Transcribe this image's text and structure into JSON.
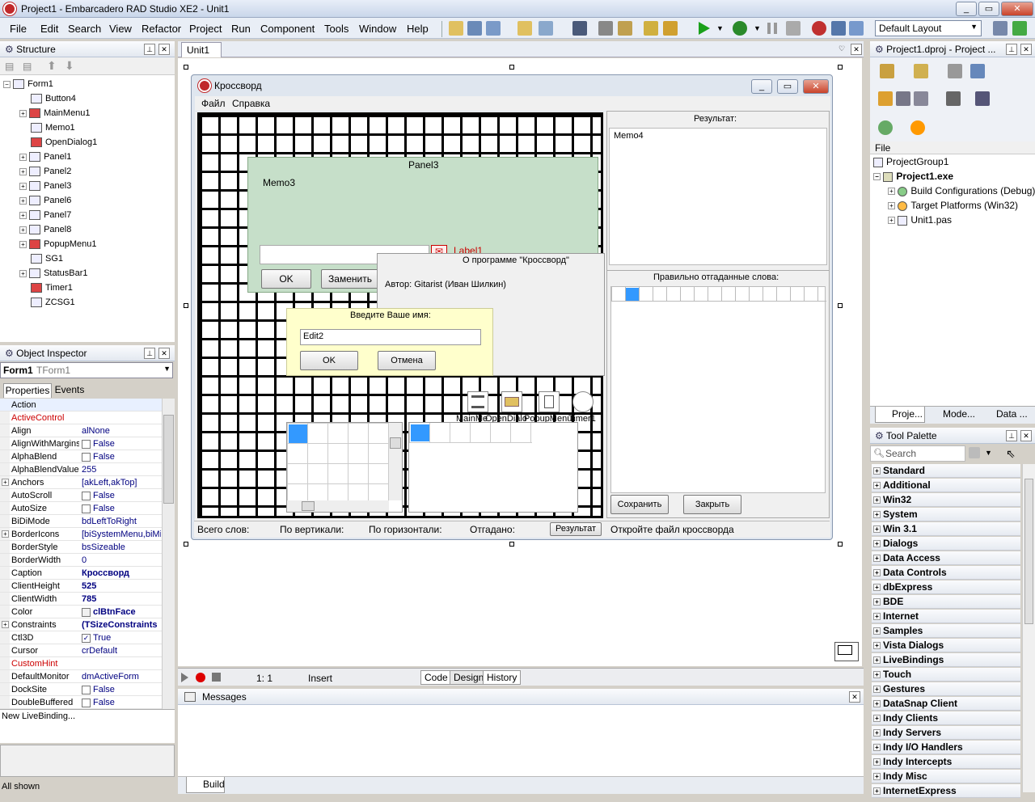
{
  "window": {
    "title": "Project1 - Embarcadero RAD Studio XE2 - Unit1"
  },
  "menu": [
    "File",
    "Edit",
    "Search",
    "View",
    "Refactor",
    "Project",
    "Run",
    "Component",
    "Tools",
    "Window",
    "Help"
  ],
  "layout_combo": "Default Layout",
  "structure": {
    "title": "Structure",
    "items": [
      "Form1",
      "Button4",
      "MainMenu1",
      "Memo1",
      "OpenDialog1",
      "Panel1",
      "Panel2",
      "Panel3",
      "Panel6",
      "Panel7",
      "Panel8",
      "PopupMenu1",
      "SG1",
      "StatusBar1",
      "Timer1",
      "ZCSG1"
    ]
  },
  "inspector": {
    "title": "Object Inspector",
    "selected": "Form1",
    "selected_type": "TForm1",
    "tabs": [
      "Properties",
      "Events"
    ],
    "props": [
      {
        "n": "Action",
        "v": ""
      },
      {
        "n": "ActiveControl",
        "v": ""
      },
      {
        "n": "Align",
        "v": "alNone"
      },
      {
        "n": "AlignWithMargins",
        "v": "False"
      },
      {
        "n": "AlphaBlend",
        "v": "False"
      },
      {
        "n": "AlphaBlendValue",
        "v": "255"
      },
      {
        "n": "Anchors",
        "v": "[akLeft,akTop]"
      },
      {
        "n": "AutoScroll",
        "v": "False"
      },
      {
        "n": "AutoSize",
        "v": "False"
      },
      {
        "n": "BiDiMode",
        "v": "bdLeftToRight"
      },
      {
        "n": "BorderIcons",
        "v": "[biSystemMenu,biMin"
      },
      {
        "n": "BorderStyle",
        "v": "bsSizeable"
      },
      {
        "n": "BorderWidth",
        "v": "0"
      },
      {
        "n": "Caption",
        "v": "Кроссворд"
      },
      {
        "n": "ClientHeight",
        "v": "525"
      },
      {
        "n": "ClientWidth",
        "v": "785"
      },
      {
        "n": "Color",
        "v": "clBtnFace"
      },
      {
        "n": "Constraints",
        "v": "(TSizeConstraints"
      },
      {
        "n": "Ctl3D",
        "v": "True"
      },
      {
        "n": "Cursor",
        "v": "crDefault"
      },
      {
        "n": "CustomHint",
        "v": ""
      },
      {
        "n": "DefaultMonitor",
        "v": "dmActiveForm"
      },
      {
        "n": "DockSite",
        "v": "False"
      },
      {
        "n": "DoubleBuffered",
        "v": "False"
      }
    ],
    "livebinding": "New LiveBinding...",
    "status": "All shown"
  },
  "editor": {
    "tab": "Unit1",
    "position": "1:  1",
    "mode": "Insert",
    "bottom_tabs": [
      "Code",
      "Design",
      "History"
    ]
  },
  "form": {
    "title": "Кроссворд",
    "menu": [
      "Файл",
      "Справка"
    ],
    "panel3_caption": "Panel3",
    "memo3": "Memo3",
    "label1": "Label1",
    "ok": "OK",
    "replace": "Заменить",
    "about_title": "О программе \"Кроссворд\"",
    "about_author": "Автор: Gitarist (Иван Шилкин)",
    "name_prompt": "Введите Ваше имя:",
    "edit2": "Edit2",
    "ok2": "OK",
    "cancel": "Отмена",
    "result_label": "Результат:",
    "memo4": "Memo4",
    "correct_words": "Правильно отгаданные слова:",
    "save": "Сохранить",
    "close": "Закрыть",
    "components": [
      "MainMe",
      "OpenDialo",
      "PopupMenu",
      "Timer1"
    ],
    "status": [
      "Всего слов:",
      "По вертикали:",
      "По горизонтали:",
      "Отгадано:",
      "Результат",
      "Откройте файл кроссворда"
    ]
  },
  "messages": {
    "title": "Messages",
    "tab": "Build"
  },
  "project": {
    "title": "Project1.dproj - Project ...",
    "file": "File",
    "items": [
      "ProjectGroup1",
      "Project1.exe",
      "Build Configurations (Debug)",
      "Target Platforms (Win32)",
      "Unit1.pas"
    ],
    "tabs": [
      "Proje...",
      "Mode...",
      "Data ..."
    ]
  },
  "palette": {
    "title": "Tool Palette",
    "search": "Search",
    "cats": [
      "Standard",
      "Additional",
      "Win32",
      "System",
      "Win 3.1",
      "Dialogs",
      "Data Access",
      "Data Controls",
      "dbExpress",
      "BDE",
      "Internet",
      "Samples",
      "Vista Dialogs",
      "LiveBindings",
      "Touch",
      "Gestures",
      "DataSnap Client",
      "Indy Clients",
      "Indy Servers",
      "Indy I/O Handlers",
      "Indy Intercepts",
      "Indy Misc",
      "InternetExpress"
    ]
  }
}
